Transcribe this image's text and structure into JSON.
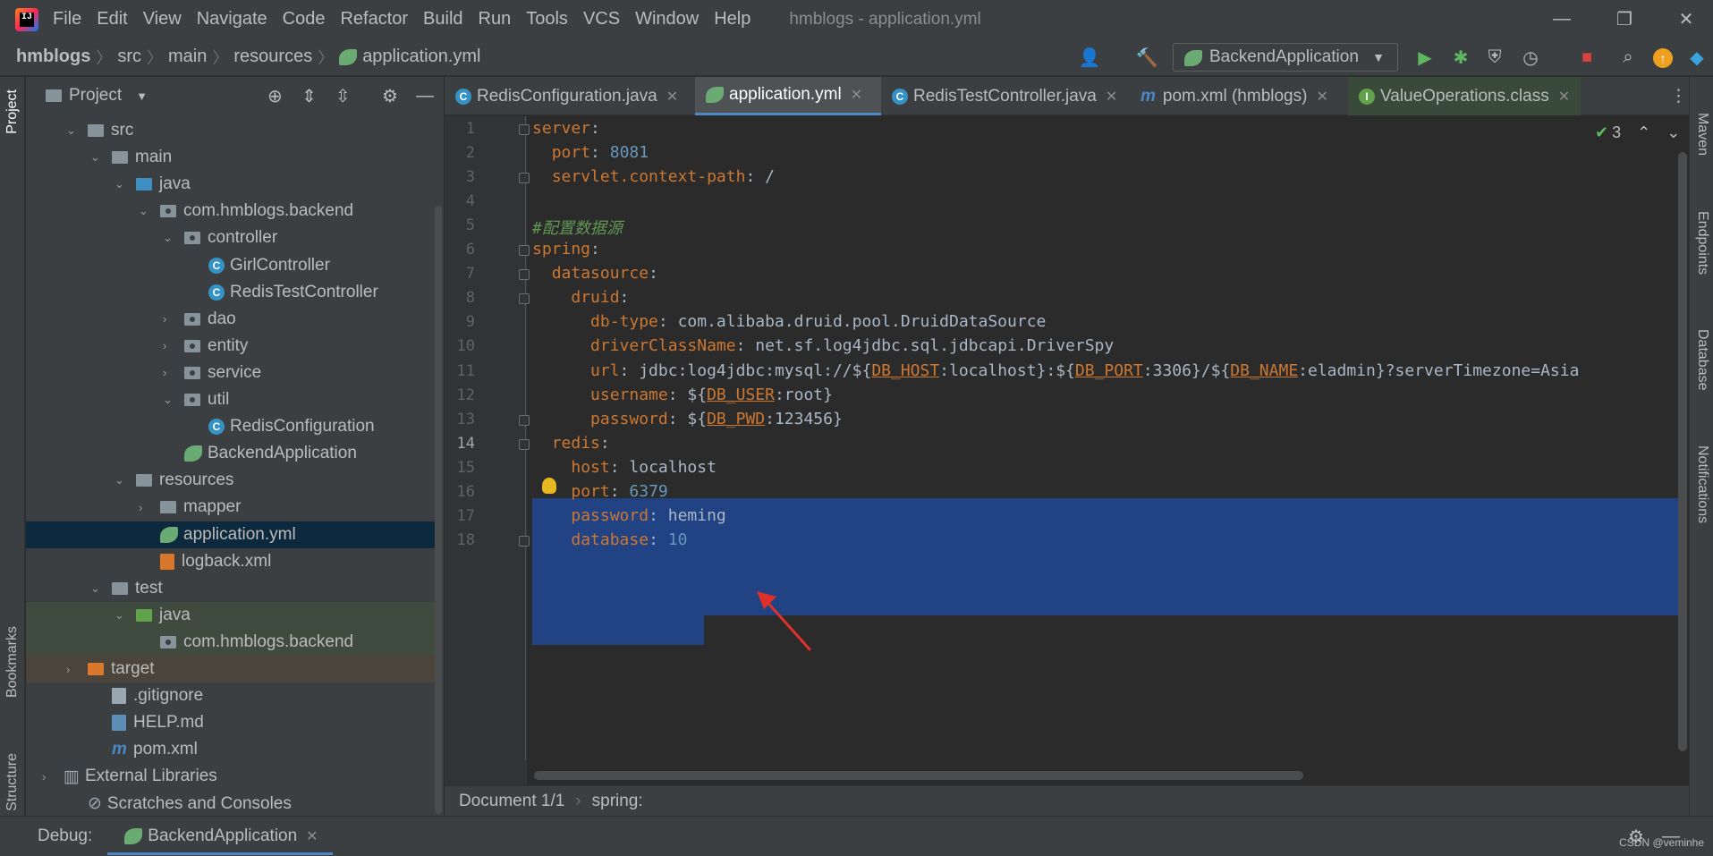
{
  "menu": [
    "File",
    "Edit",
    "View",
    "Navigate",
    "Code",
    "Refactor",
    "Build",
    "Run",
    "Tools",
    "VCS",
    "Window",
    "Help"
  ],
  "window_title": "hmblogs - application.yml",
  "breadcrumbs": [
    "hmblogs",
    "src",
    "main",
    "resources",
    "application.yml"
  ],
  "run_config": "BackendApplication",
  "project_panel": {
    "title": "Project"
  },
  "tree": [
    {
      "label": "src",
      "indent": 1,
      "type": "folder",
      "arrow": "open"
    },
    {
      "label": "main",
      "indent": 2,
      "type": "folder",
      "arrow": "open"
    },
    {
      "label": "java",
      "indent": 3,
      "type": "folder-blue",
      "arrow": "open"
    },
    {
      "label": "com.hmblogs.backend",
      "indent": 4,
      "type": "package",
      "arrow": "open"
    },
    {
      "label": "controller",
      "indent": 5,
      "type": "package",
      "arrow": "open"
    },
    {
      "label": "GirlController",
      "indent": 6,
      "type": "class"
    },
    {
      "label": "RedisTestController",
      "indent": 6,
      "type": "class"
    },
    {
      "label": "dao",
      "indent": 5,
      "type": "package",
      "arrow": "closed"
    },
    {
      "label": "entity",
      "indent": 5,
      "type": "package",
      "arrow": "closed"
    },
    {
      "label": "service",
      "indent": 5,
      "type": "package",
      "arrow": "closed"
    },
    {
      "label": "util",
      "indent": 5,
      "type": "package",
      "arrow": "open"
    },
    {
      "label": "RedisConfiguration",
      "indent": 6,
      "type": "class"
    },
    {
      "label": "BackendApplication",
      "indent": 5,
      "type": "spring"
    },
    {
      "label": "resources",
      "indent": 3,
      "type": "folder",
      "arrow": "open"
    },
    {
      "label": "mapper",
      "indent": 4,
      "type": "folder",
      "arrow": "closed"
    },
    {
      "label": "application.yml",
      "indent": 4,
      "type": "spring",
      "selected": true
    },
    {
      "label": "logback.xml",
      "indent": 4,
      "type": "xml"
    },
    {
      "label": "test",
      "indent": 2,
      "type": "folder",
      "arrow": "open"
    },
    {
      "label": "java",
      "indent": 3,
      "type": "folder-green",
      "arrow": "open",
      "test": true
    },
    {
      "label": "com.hmblogs.backend",
      "indent": 4,
      "type": "package",
      "test": true
    },
    {
      "label": "target",
      "indent": 1,
      "type": "folder-orange",
      "arrow": "closed",
      "excluded": true
    },
    {
      "label": ".gitignore",
      "indent": 2,
      "type": "file"
    },
    {
      "label": "HELP.md",
      "indent": 2,
      "type": "md"
    },
    {
      "label": "pom.xml",
      "indent": 2,
      "type": "maven"
    },
    {
      "label": "External Libraries",
      "indent": 0,
      "type": "lib",
      "arrow": "closed"
    },
    {
      "label": "Scratches and Consoles",
      "indent": 1,
      "type": "scratch"
    }
  ],
  "tabs": [
    {
      "label": "RedisConfiguration.java",
      "icon": "C"
    },
    {
      "label": "application.yml",
      "icon": "spring",
      "active": true
    },
    {
      "label": "RedisTestController.java",
      "icon": "C"
    },
    {
      "label": "pom.xml (hmblogs)",
      "icon": "m"
    },
    {
      "label": "ValueOperations.class",
      "icon": "I"
    }
  ],
  "inspection_count": "3",
  "code_lines": [
    {
      "n": "1",
      "parts": [
        [
          "k",
          "server"
        ],
        [
          "v",
          ":"
        ]
      ]
    },
    {
      "n": "2",
      "parts": [
        [
          "v",
          "  "
        ],
        [
          "k",
          "port"
        ],
        [
          "v",
          ": "
        ],
        [
          "n",
          "8081"
        ]
      ]
    },
    {
      "n": "3",
      "parts": [
        [
          "v",
          "  "
        ],
        [
          "k",
          "servlet.context-path"
        ],
        [
          "v",
          ": /"
        ]
      ]
    },
    {
      "n": "4",
      "parts": []
    },
    {
      "n": "5",
      "parts": [
        [
          "cm",
          "#配置数据源"
        ]
      ]
    },
    {
      "n": "6",
      "parts": [
        [
          "k",
          "spring"
        ],
        [
          "v",
          ":"
        ]
      ]
    },
    {
      "n": "7",
      "parts": [
        [
          "v",
          "  "
        ],
        [
          "k",
          "datasource"
        ],
        [
          "v",
          ":"
        ]
      ]
    },
    {
      "n": "8",
      "parts": [
        [
          "v",
          "    "
        ],
        [
          "k",
          "druid"
        ],
        [
          "v",
          ":"
        ]
      ]
    },
    {
      "n": "9",
      "parts": [
        [
          "v",
          "      "
        ],
        [
          "k",
          "db-type"
        ],
        [
          "v",
          ": com.alibaba.druid.pool.DruidDataSource"
        ]
      ]
    },
    {
      "n": "10",
      "parts": [
        [
          "v",
          "      "
        ],
        [
          "k",
          "driverClassName"
        ],
        [
          "v",
          ": net.sf.log4jdbc.sql.jdbcapi.DriverSpy"
        ]
      ]
    },
    {
      "n": "11",
      "parts": [
        [
          "v",
          "      "
        ],
        [
          "k",
          "url"
        ],
        [
          "v",
          ": jdbc:log4jdbc:mysql://${"
        ],
        [
          "u",
          "DB_HOST"
        ],
        [
          "v",
          ":localhost}:${"
        ],
        [
          "u",
          "DB_PORT"
        ],
        [
          "v",
          ":3306}/${"
        ],
        [
          "u",
          "DB_NAME"
        ],
        [
          "v",
          ":eladmin}?serverTimezone=Asia"
        ]
      ]
    },
    {
      "n": "12",
      "parts": [
        [
          "v",
          "      "
        ],
        [
          "k",
          "username"
        ],
        [
          "v",
          ": ${"
        ],
        [
          "u",
          "DB_USER"
        ],
        [
          "v",
          ":root}"
        ]
      ]
    },
    {
      "n": "13",
      "parts": [
        [
          "v",
          "      "
        ],
        [
          "k",
          "password"
        ],
        [
          "v",
          ": ${"
        ],
        [
          "u",
          "DB_PWD"
        ],
        [
          "v",
          ":123456}"
        ]
      ]
    },
    {
      "n": "14",
      "parts": [
        [
          "v",
          "  "
        ],
        [
          "k",
          "redis"
        ],
        [
          "v",
          ":"
        ]
      ]
    },
    {
      "n": "15",
      "parts": [
        [
          "v",
          "    "
        ],
        [
          "k",
          "host"
        ],
        [
          "v",
          ": localhost"
        ]
      ]
    },
    {
      "n": "16",
      "parts": [
        [
          "v",
          "    "
        ],
        [
          "k",
          "port"
        ],
        [
          "v",
          ": "
        ],
        [
          "n",
          "6379"
        ]
      ]
    },
    {
      "n": "17",
      "parts": [
        [
          "v",
          "    "
        ],
        [
          "k",
          "password"
        ],
        [
          "v",
          ": heming"
        ]
      ]
    },
    {
      "n": "18",
      "parts": [
        [
          "v",
          "    "
        ],
        [
          "k",
          "database"
        ],
        [
          "v",
          ": "
        ],
        [
          "n",
          "10"
        ]
      ]
    }
  ],
  "status": {
    "doc": "Document 1/1",
    "path": "spring:"
  },
  "debug": {
    "label": "Debug:",
    "config": "BackendApplication"
  },
  "side_left": [
    "Project",
    "Bookmarks",
    "Structure"
  ],
  "side_right": [
    "Maven",
    "Endpoints",
    "Database",
    "Notifications"
  ],
  "watermark": "CSDN @veminhe",
  "colors": {
    "accent": "#4a88c7",
    "selection": "#214283",
    "keyword": "#cc7832",
    "number": "#6897bb",
    "comment": "#629755"
  }
}
